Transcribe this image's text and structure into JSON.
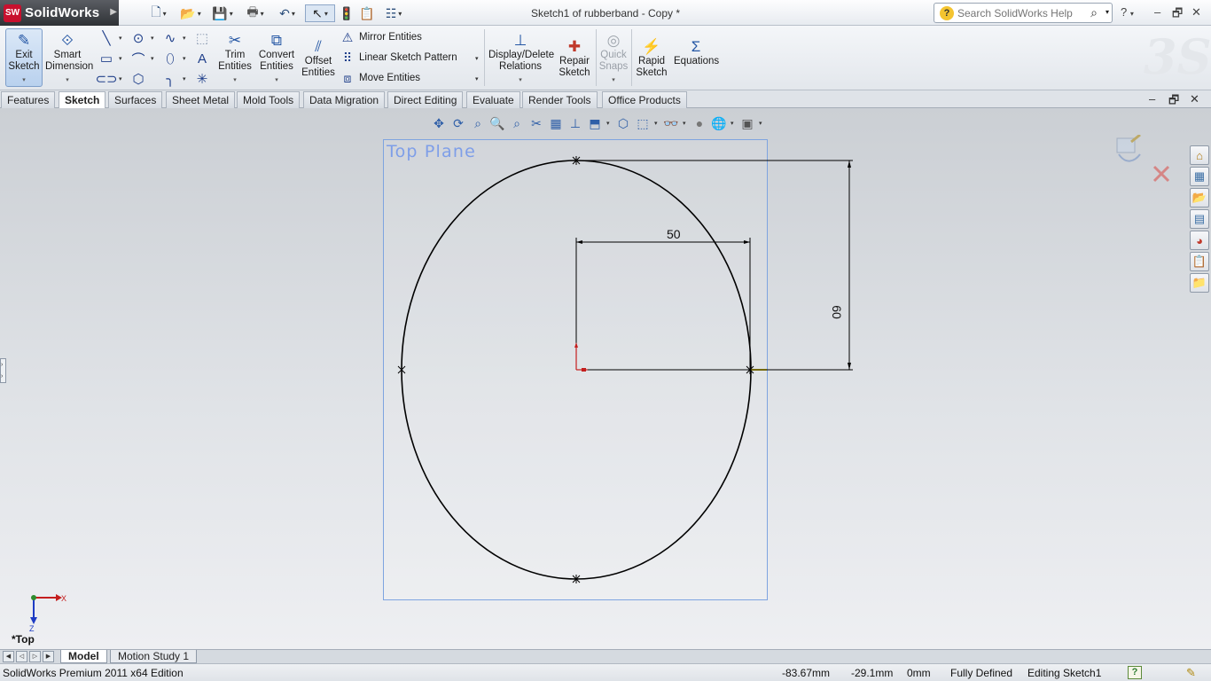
{
  "app": {
    "brand": "SolidWorks",
    "document_title": "Sketch1 of rubberband - Copy *"
  },
  "search": {
    "placeholder": "Search SolidWorks Help"
  },
  "ribbon": {
    "exit_sketch": "Exit Sketch",
    "smart_dimension": "Smart Dimension",
    "trim_entities": "Trim Entities",
    "convert_entities": "Convert Entities",
    "offset_entities": "Offset Entities",
    "mirror_entities": "Mirror Entities",
    "linear_sketch_pattern": "Linear Sketch Pattern",
    "move_entities": "Move Entities",
    "display_delete_relations": "Display/Delete Relations",
    "repair_sketch": "Repair Sketch",
    "quick_snaps": "Quick Snaps",
    "rapid_sketch": "Rapid Sketch",
    "equations": "Equations"
  },
  "tabs": [
    {
      "label": "Features"
    },
    {
      "label": "Sketch",
      "active": true
    },
    {
      "label": "Surfaces"
    },
    {
      "label": "Sheet Metal"
    },
    {
      "label": "Mold Tools"
    },
    {
      "label": "Data Migration"
    },
    {
      "label": "Direct Editing"
    },
    {
      "label": "Evaluate"
    },
    {
      "label": "Render Tools"
    },
    {
      "label": "Office Products"
    }
  ],
  "viewport": {
    "plane_label": "Top Plane",
    "dimension_horizontal": "50",
    "dimension_vertical": "60",
    "view_orientation": "*Top",
    "triad_x": "X",
    "triad_z": "Z"
  },
  "bottom_tabs": [
    {
      "label": "Model",
      "active": true
    },
    {
      "label": "Motion Study 1"
    }
  ],
  "status": {
    "edition": "SolidWorks Premium 2011 x64 Edition",
    "x_coord": "-83.67mm",
    "y_coord": "-29.1mm",
    "z_coord": "0mm",
    "definition": "Fully Defined",
    "mode": "Editing Sketch1"
  },
  "colors": {
    "plane_outline": "#7ea4e0",
    "plane_label": "#7e9ee8",
    "sketch_lines": "#000000",
    "origin": "#c41e1e",
    "active_tab_bg": "#ffffff",
    "exit_sketch_highlight": "#b9d1ee"
  }
}
